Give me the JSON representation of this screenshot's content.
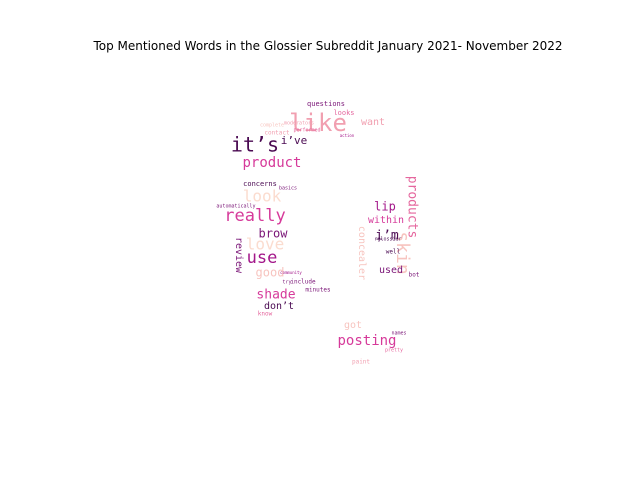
{
  "title": "Top Mentioned Words in the Glossier Subreddit January 2021- November 2022",
  "colors": {
    "background": "#ffffff",
    "text": "#000000",
    "palette": [
      "#4a0a52",
      "#7a1577",
      "#a3178a",
      "#d63a9a",
      "#e5679e",
      "#f19fb0",
      "#f7c4bf",
      "#fbdccf"
    ]
  },
  "word_cloud": {
    "shape": "letter G",
    "words": [
      {
        "text": "like",
        "color": "#f19fb0"
      },
      {
        "text": "it’s",
        "color": "#4a0a52"
      },
      {
        "text": "product",
        "color": "#d63a9a"
      },
      {
        "text": "really",
        "color": "#d63a9a"
      },
      {
        "text": "skin",
        "color": "#f7c4bf"
      },
      {
        "text": "use",
        "color": "#a3178a"
      },
      {
        "text": "love",
        "color": "#fbdccf"
      },
      {
        "text": "look",
        "color": "#fbdccf"
      },
      {
        "text": "posting",
        "color": "#d63a9a"
      },
      {
        "text": "products",
        "color": "#e5679e"
      },
      {
        "text": "shade",
        "color": "#d63a9a"
      },
      {
        "text": "i’m",
        "color": "#4a0a52"
      },
      {
        "text": "brow",
        "color": "#7a1577"
      },
      {
        "text": "lip",
        "color": "#a3178a"
      },
      {
        "text": "good",
        "color": "#f7c4bf"
      },
      {
        "text": "i’ve",
        "color": "#4a0a52"
      },
      {
        "text": "want",
        "color": "#f19fb0"
      },
      {
        "text": "concealer",
        "color": "#f7c4bf"
      },
      {
        "text": "review",
        "color": "#7a1577"
      },
      {
        "text": "within",
        "color": "#d63a9a"
      },
      {
        "text": "don’t",
        "color": "#4a0a52"
      },
      {
        "text": "used",
        "color": "#7a1577"
      },
      {
        "text": "got",
        "color": "#f7c4bf"
      },
      {
        "text": "questions",
        "color": "#7a1577"
      },
      {
        "text": "looks",
        "color": "#e5679e"
      },
      {
        "text": "concerns",
        "color": "#4a0a52"
      },
      {
        "text": "include",
        "color": "#7a1577"
      },
      {
        "text": "minutes",
        "color": "#7a1577"
      },
      {
        "text": "well",
        "color": "#4a0a52"
      },
      {
        "text": "bot",
        "color": "#7a1577"
      },
      {
        "text": "know",
        "color": "#e5679e"
      },
      {
        "text": "contact",
        "color": "#f19fb0"
      },
      {
        "text": "basics",
        "color": "#7a1577"
      },
      {
        "text": "rglossier",
        "color": "#4a0a52"
      },
      {
        "text": "names",
        "color": "#7a1577"
      },
      {
        "text": "pretty",
        "color": "#e5679e"
      },
      {
        "text": "paint",
        "color": "#f19fb0"
      },
      {
        "text": "performed",
        "color": "#e5679e"
      },
      {
        "text": "automatically",
        "color": "#7a1577"
      },
      {
        "text": "community",
        "color": "#a3178a"
      },
      {
        "text": "try",
        "color": "#7a1577"
      },
      {
        "text": "complete",
        "color": "#f7c4bf"
      },
      {
        "text": "moderators",
        "color": "#f19fb0"
      },
      {
        "text": "action",
        "color": "#a3178a"
      }
    ]
  }
}
